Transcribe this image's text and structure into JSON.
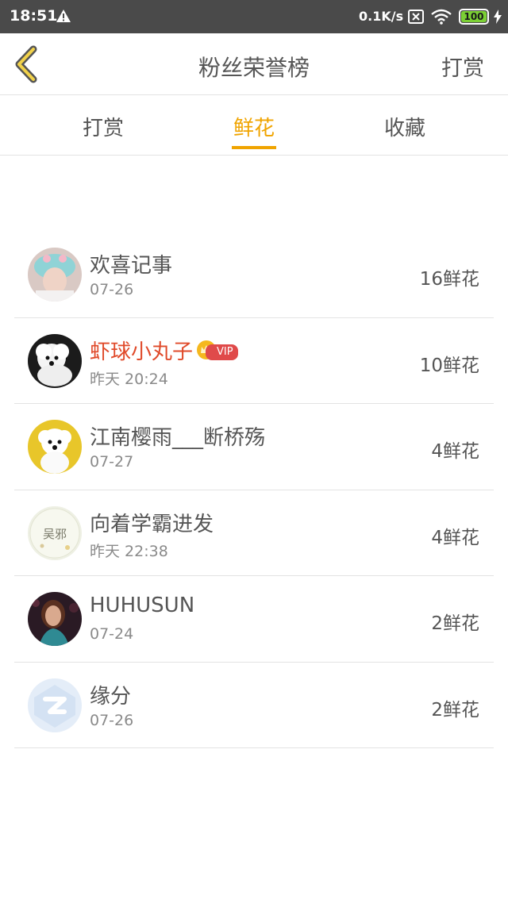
{
  "status_bar": {
    "time": "18:51",
    "speed": "0.1K/s",
    "battery": "100"
  },
  "header": {
    "title": "粉丝荣誉榜",
    "right_action": "打赏"
  },
  "tabs": [
    {
      "label": "打赏",
      "active": false
    },
    {
      "label": "鲜花",
      "active": true
    },
    {
      "label": "收藏",
      "active": false
    }
  ],
  "accent_color": "#f0a400",
  "fans": [
    {
      "name": "欢喜记事",
      "date": "07-26",
      "amount": "16鲜花",
      "vip": false,
      "avatar_icon": "avatar-girl-hat"
    },
    {
      "name": "虾球小丸子",
      "date": "昨天 20:24",
      "amount": "10鲜花",
      "vip": true,
      "vip_label": "VIP",
      "avatar_icon": "avatar-white-dog"
    },
    {
      "name": "江南樱雨___断桥殇",
      "date": "07-27",
      "amount": "4鲜花",
      "vip": false,
      "avatar_icon": "avatar-white-dog-yellow"
    },
    {
      "name": "向着学霸进发",
      "date": "昨天 22:38",
      "amount": "4鲜花",
      "vip": false,
      "avatar_icon": "avatar-calligraphy",
      "avatar_text": "吴邪"
    },
    {
      "name": "HUHUSUN",
      "date": "07-24",
      "amount": "2鲜花",
      "vip": false,
      "avatar_icon": "avatar-woman-portrait"
    },
    {
      "name": "缘分",
      "date": "07-26",
      "amount": "2鲜花",
      "vip": false,
      "avatar_icon": "avatar-default-qq"
    }
  ]
}
